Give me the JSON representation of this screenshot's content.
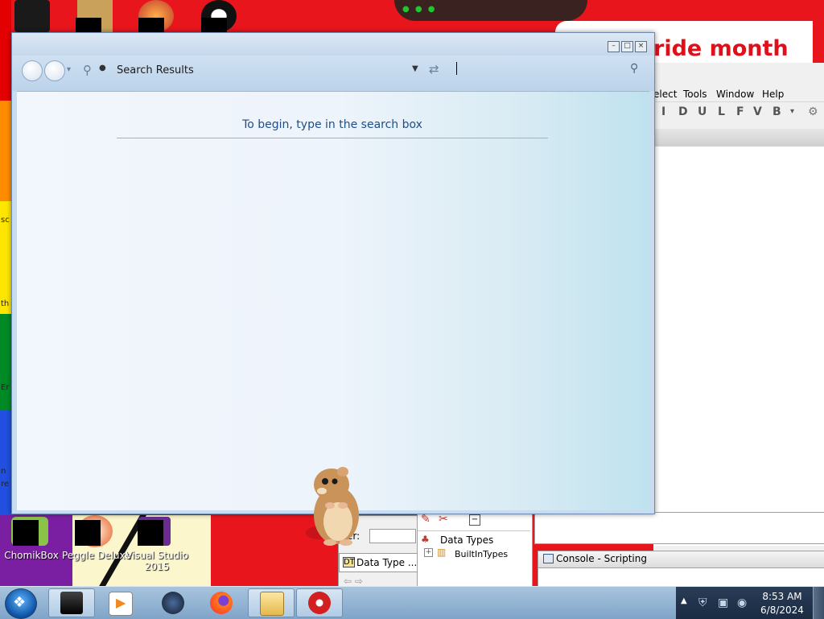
{
  "desktop": {
    "banner_text": "ride month",
    "rainbow_fragments": [
      "sc",
      "th",
      "Er",
      "n",
      "re"
    ],
    "icons": [
      {
        "label": "ChomikBox"
      },
      {
        "label": "Peggle Deluxe"
      },
      {
        "label": "Visual Studio 2015"
      }
    ]
  },
  "background_app": {
    "menu": [
      "elect",
      "Tools",
      "Window",
      "Help"
    ],
    "toolbar_letters": [
      "I",
      "D",
      "U",
      "L",
      "F",
      "V",
      "B"
    ],
    "left_panel_label": "er:",
    "left_panel_tab": "Data Type ...",
    "tree": {
      "root": "Data Types",
      "child": "BuiltInTypes"
    },
    "console_title": "Console - Scripting"
  },
  "search_window": {
    "address_text": "Search Results",
    "hint_text": "To begin, type in the search box",
    "search_placeholder": ""
  },
  "taskbar": {
    "clock_time": "8:53 AM",
    "clock_date": "6/8/2024",
    "apps": [
      {
        "name": "terminal-icon"
      },
      {
        "name": "media-player-icon"
      },
      {
        "name": "globe-app-icon"
      },
      {
        "name": "firefox-icon"
      },
      {
        "name": "file-explorer-icon"
      },
      {
        "name": "red-bird-app-icon"
      }
    ]
  },
  "colors": {
    "wallpaper_red": "#e8151c",
    "window_accent": "#1f4e87",
    "taskbar": "#8aaccd"
  }
}
